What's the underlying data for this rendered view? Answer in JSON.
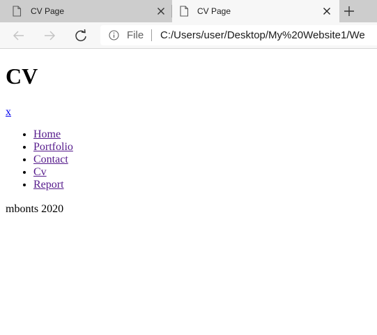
{
  "browser": {
    "tabs": [
      {
        "title": "CV Page",
        "active": false,
        "icon": "page-icon"
      },
      {
        "title": "CV Page",
        "active": true,
        "icon": "page-icon"
      }
    ],
    "scheme_label": "File",
    "url": "C:/Users/user/Desktop/My%20Website1/We",
    "buttons": {
      "back": "arrow-left-icon",
      "forward": "arrow-right-icon",
      "refresh": "refresh-icon",
      "new_tab": "plus-icon",
      "close_tab": "close-icon",
      "site_info": "info-icon"
    }
  },
  "page": {
    "title": "CV",
    "close_link": "x",
    "nav_items": [
      {
        "label": "Home"
      },
      {
        "label": "Portfolio"
      },
      {
        "label": "Contact"
      },
      {
        "label": "Cv"
      },
      {
        "label": "Report"
      }
    ],
    "footer": "mbonts 2020"
  },
  "colors": {
    "tabstrip": "#cdcdcd",
    "toolbar": "#f7f7f7",
    "link_unvisited": "#0000ee",
    "link_visited": "#551a8b"
  }
}
